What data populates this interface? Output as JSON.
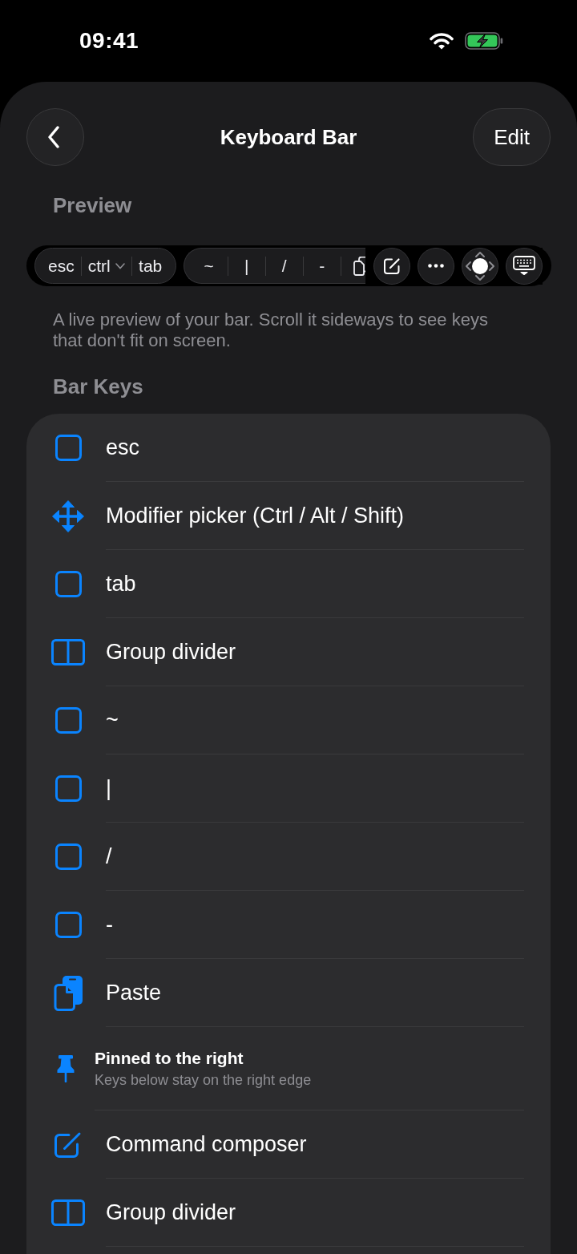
{
  "status_bar": {
    "time": "09:41"
  },
  "nav": {
    "title": "Keyboard Bar",
    "action": "Edit"
  },
  "preview": {
    "heading": "Preview",
    "groups": [
      {
        "keys": [
          {
            "kind": "text",
            "label": "esc"
          },
          {
            "kind": "menu",
            "label": "ctrl"
          },
          {
            "kind": "text",
            "label": "tab"
          }
        ]
      },
      {
        "keys": [
          {
            "kind": "text",
            "label": "~"
          },
          {
            "kind": "text",
            "label": "|"
          },
          {
            "kind": "text",
            "label": "/"
          },
          {
            "kind": "text",
            "label": "-"
          },
          {
            "kind": "paste"
          }
        ]
      }
    ],
    "pinned": [
      {
        "kind": "composer"
      },
      {
        "kind": "more"
      },
      {
        "kind": "joystick"
      },
      {
        "kind": "keyboard"
      }
    ],
    "caption": "A live preview of your bar. Scroll it sideways to see keys that don't fit on screen."
  },
  "bar_keys": {
    "heading": "Bar Keys",
    "items": [
      {
        "kind": "key",
        "label": "esc"
      },
      {
        "kind": "modifier",
        "label": "Modifier picker (Ctrl / Alt / Shift)"
      },
      {
        "kind": "key",
        "label": "tab"
      },
      {
        "kind": "divider",
        "label": "Group divider"
      },
      {
        "kind": "key",
        "label": "~"
      },
      {
        "kind": "key",
        "label": "|"
      },
      {
        "kind": "key",
        "label": "/"
      },
      {
        "kind": "key",
        "label": "-"
      },
      {
        "kind": "paste",
        "label": "Paste"
      },
      {
        "kind": "pin",
        "title": "Pinned to the right",
        "subtitle": "Keys below stay on the right edge"
      },
      {
        "kind": "composer",
        "label": "Command composer"
      },
      {
        "kind": "divider",
        "label": "Group divider"
      }
    ]
  }
}
